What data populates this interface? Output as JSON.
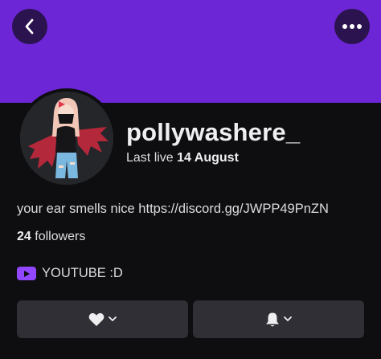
{
  "profile": {
    "username": "pollywashere_",
    "last_live_prefix": "Last live",
    "last_live_date": "14 August",
    "bio": "your ear smells nice https://discord.gg/JWPP49PnZN",
    "followers_count": "24",
    "followers_label": "followers"
  },
  "social": {
    "label": "YOUTUBE :D",
    "icon": "youtube-icon"
  },
  "actions": {
    "follow_icon": "heart-icon",
    "notify_icon": "bell-icon"
  },
  "header": {
    "back_icon": "chevron-left-icon",
    "more_icon": "more-dots-icon"
  },
  "colors": {
    "banner": "#6d26d6",
    "background": "#0e0e10",
    "button": "#2f2f35",
    "accent": "#9147ff"
  }
}
